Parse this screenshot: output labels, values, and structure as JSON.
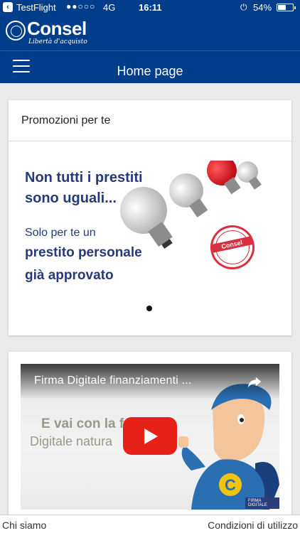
{
  "status_bar": {
    "carrier": "TestFlight",
    "signal": "●●○○○",
    "network": "4G",
    "time": "16:11",
    "battery_percent_text": "54%",
    "battery_level": 0.54
  },
  "brand": {
    "name": "Consel",
    "tagline": "Libertà d'acquisto"
  },
  "navbar": {
    "title": "Home page"
  },
  "promo_card": {
    "title": "Promozioni per te",
    "banner": {
      "line1": "Non tutti i prestiti",
      "line2": "sono uguali...",
      "line3": "Solo per te un",
      "line4": "prestito personale",
      "line5": "già approvato",
      "stamp_text": "Consel"
    }
  },
  "video_card": {
    "video_title": "Firma Digitale finanziamenti ...",
    "overlay_line1": "E vai con la f",
    "overlay_line2": "Digitale natura",
    "badge": "FIRMA DIGITALE"
  },
  "footer": {
    "left_link": "Chi siamo",
    "right_link": "Condizioni di utilizzo"
  },
  "colors": {
    "brand_blue": "#003d8a",
    "promo_text": "#253a7a",
    "stamp_red": "#d93040",
    "youtube_red": "#e62117"
  }
}
